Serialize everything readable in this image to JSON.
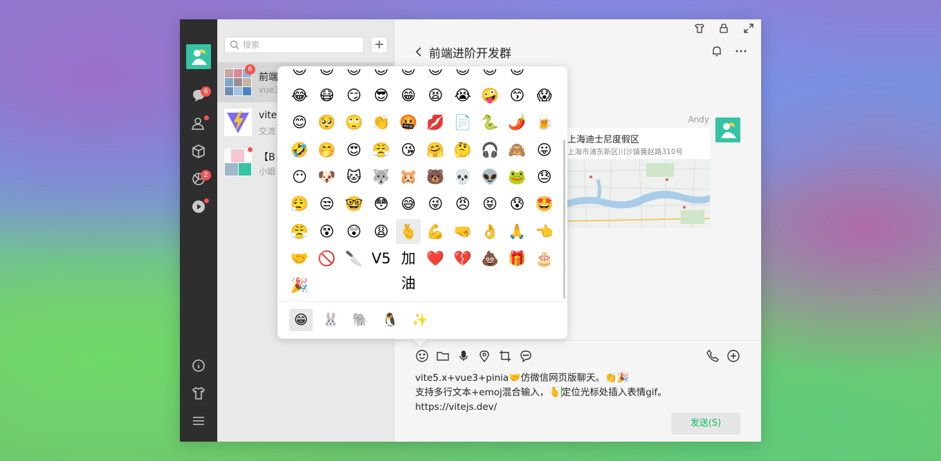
{
  "nav": {
    "chat_badge": "6",
    "moments_badge": "2"
  },
  "list": {
    "search_placeholder": "搜索",
    "add_label": "+",
    "chats": [
      {
        "name": "前端",
        "preview": "vue3",
        "badge": "6"
      },
      {
        "name": "vite",
        "preview": "交流"
      },
      {
        "name": "【B",
        "preview": "小姐"
      }
    ]
  },
  "chat": {
    "title": "前端进阶开发群",
    "sender": "Andy",
    "location": {
      "title": "上海迪士尼度假区",
      "address": "上海市浦东新区川沙镇黄赵路310号"
    },
    "editor": {
      "line1_a": "vite5.x+vue3+pinia",
      "line1_emoji1": "🤝",
      "line1_b": "仿微信网页版聊天。",
      "line1_emoji2": "👏🎉",
      "line2_a": "支持多行文本+emoj混合输入，",
      "line2_emoji": "🫰",
      "line2_b": "定位光标处插入表情gif。",
      "line3": "https://vitejs.dev/"
    },
    "send_label": "发送(S)"
  },
  "emoji_panel": {
    "partial_row": [
      "😊",
      "😊",
      "😊",
      "😊",
      "😊",
      "😊",
      "😊",
      "😊",
      "😊"
    ],
    "rows": [
      [
        "😂",
        "😷",
        "😏",
        "😎",
        "😁",
        "😫",
        "😭",
        "🤪",
        "😙",
        "😱"
      ],
      [
        "😊",
        "🥺",
        "🙄",
        "👏",
        "🤬",
        "💋",
        "📄",
        "🐍",
        "🌶️",
        "🍺"
      ],
      [
        "🤣",
        "🤭",
        "😍",
        "😤",
        "😘",
        "🤗",
        "🤔",
        "🎧",
        "🙈",
        "😛"
      ],
      [
        "😶",
        "🐶",
        "🐱",
        "🐺",
        "🐹",
        "🐻",
        "💀",
        "👽",
        "🐸",
        "😓"
      ],
      [
        "😮‍💨",
        "😒",
        "🤓",
        "😳",
        "😅",
        "😜",
        "😠",
        "😝",
        "😰",
        "🤩"
      ],
      [
        "😤",
        "😵",
        "😲",
        "😩",
        "🫰",
        "💪",
        "🤜",
        "👌",
        "🙏",
        "👈"
      ],
      [
        "🤝",
        "🚫",
        "🔪",
        "V5",
        "加油",
        "❤️",
        "💔",
        "💩",
        "🎁",
        "🎂"
      ],
      [
        "🎉"
      ]
    ],
    "tabs": [
      "😁",
      "🐰",
      "🐘",
      "🐧",
      "✨"
    ]
  },
  "colors": {
    "accent": "#07c160",
    "badge": "#f5544d",
    "sidebar": "#2e2e2e"
  }
}
